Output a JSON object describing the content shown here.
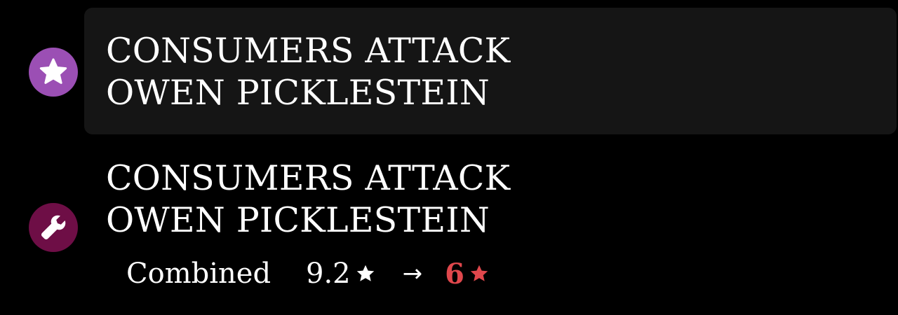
{
  "colors": {
    "background": "#000000",
    "card_background": "#151515",
    "favorite_icon_bg": "#9b4fb4",
    "tools_icon_bg": "#6e0e46",
    "new_rating": "#e0474c",
    "text": "#ffffff"
  },
  "entries": [
    {
      "icon": "star-icon",
      "title_line1": "CONSUMERS ATTACK",
      "title_line2": "OWEN PICKLESTEIN"
    },
    {
      "icon": "wrench-icon",
      "title_line1": "CONSUMERS ATTACK",
      "title_line2": "OWEN PICKLESTEIN",
      "rating": {
        "label": "Combined",
        "old_value": "9.2",
        "arrow": "→",
        "new_value": "6"
      }
    }
  ]
}
